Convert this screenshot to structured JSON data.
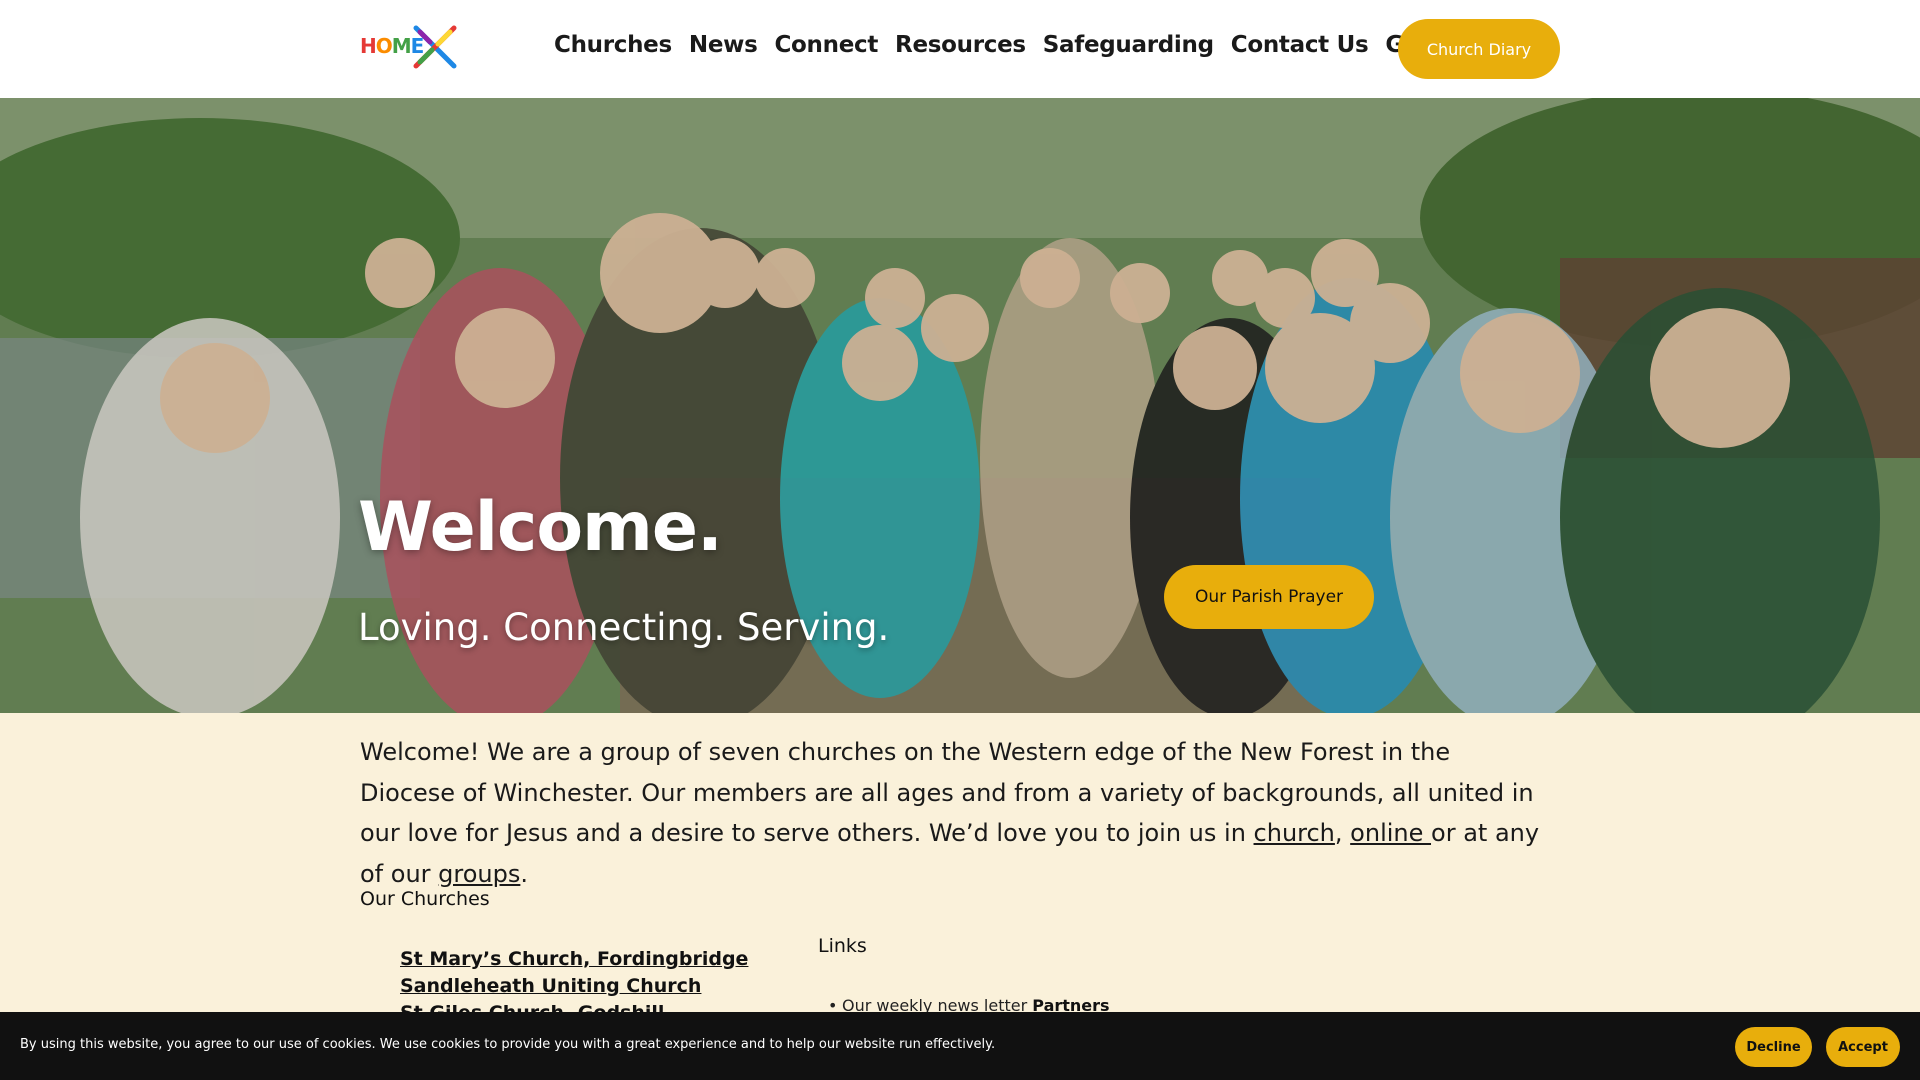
{
  "header": {
    "logo_text": [
      "H",
      "O",
      "M",
      "E"
    ],
    "nav": [
      "Churches",
      "News",
      "Connect",
      "Resources",
      "Safeguarding",
      "Contact Us",
      "Give"
    ],
    "diary_button": "Church Diary"
  },
  "hero": {
    "title": "Welcome.",
    "subtitle": "Loving. Connecting. Serving.",
    "prayer_button": "Our Parish Prayer"
  },
  "intro": {
    "text_before": "Welcome! We are a group of seven churches on the Western edge of the New Forest in the Diocese of Winchester. Our members are all ages and from a variety of backgrounds, all united in our love for Jesus and a desire to serve others. We’d love you to join us in ",
    "link_church": "church",
    "sep1": ", ",
    "link_online": "online ",
    "text_mid": "or at any of our ",
    "link_groups": "groups",
    "text_end": "."
  },
  "churches": {
    "heading": "Our Churches",
    "items": [
      "St Mary’s Church, Fordingbridge",
      "Sandleheath Uniting Church",
      "St Giles Church, Godshill"
    ]
  },
  "links": {
    "heading": "Links",
    "item_prefix": "Our weekly news letter ",
    "item_bold": "Partners"
  },
  "cookie": {
    "text": "By using this website, you agree to our use of cookies. We use cookies to provide you with a great experience and to help our website run effectively.",
    "decline": "Decline",
    "accept": "Accept"
  },
  "colors": {
    "accent": "#e8ae0c",
    "content_bg": "#faf1da",
    "cookie_bg": "#111111"
  }
}
